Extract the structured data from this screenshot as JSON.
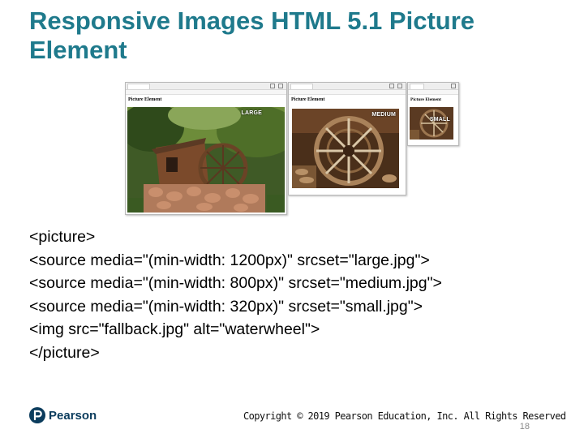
{
  "slide": {
    "title_line1": "Responsive Images HTML 5.1 Picture",
    "title_line2": "Element",
    "code_lines": [
      "<picture>",
      "<source media=\"(min-width: 1200px)\" srcset=\"large.jpg\">",
      "<source media=\"(min-width: 800px)\" srcset=\"medium.jpg\">",
      "<source media=\"(min-width: 320px)\" srcset=\"small.jpg\">",
      "<img src=\"fallback.jpg\" alt=\"waterwheel\">",
      "</picture>"
    ],
    "copyright": "Copyright © 2019 Pearson Education, Inc. All Rights Reserved",
    "page_number": "18",
    "logo_text": "Pearson"
  },
  "screenshots": {
    "large": {
      "heading": "Picture Element",
      "tag": "LARGE"
    },
    "medium": {
      "heading": "Picture Element",
      "tag": "MEDIUM"
    },
    "small": {
      "heading": "Picture Element",
      "tag": "SMALL"
    }
  },
  "colors": {
    "title": "#1f7a8c",
    "logo": "#0b3c5d"
  }
}
